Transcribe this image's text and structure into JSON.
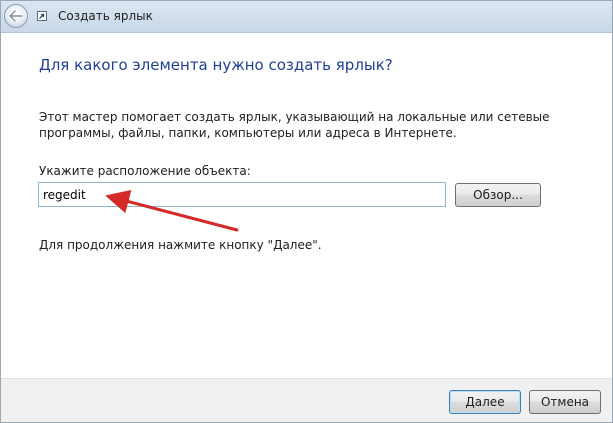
{
  "window": {
    "title": "Создать ярлык"
  },
  "wizard": {
    "heading": "Для какого элемента нужно создать ярлык?",
    "description": "Этот мастер помогает создать ярлык, указывающий на локальные или сетевые программы, файлы, папки, компьютеры или адреса в Интернете.",
    "location_label": "Укажите расположение объекта:",
    "location_value": "regedit",
    "browse_label": "Обзор...",
    "hint": "Для продолжения нажмите кнопку \"Далее\"."
  },
  "footer": {
    "next_label": "Далее",
    "cancel_label": "Отмена"
  },
  "colors": {
    "heading": "#1f3f95",
    "arrow": "#d42a2a",
    "footer_background": "#f0f0f0"
  },
  "icons": {
    "back": "back-arrow-icon",
    "shortcut": "shortcut-icon"
  }
}
